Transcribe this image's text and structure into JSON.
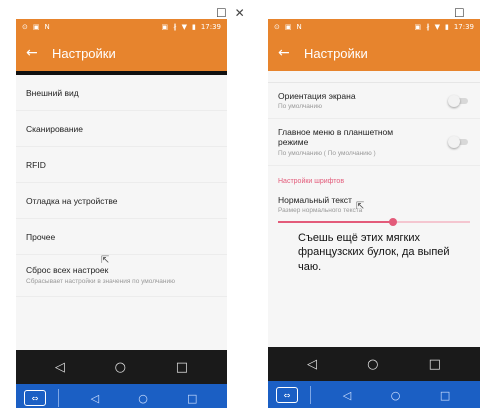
{
  "window_controls": "☐ ✕",
  "status_time": "17:39",
  "status_left_icons": [
    "⊙",
    "▣",
    "N"
  ],
  "status_right_icons": [
    "▣",
    "∦",
    "▼",
    "▮"
  ],
  "screen1": {
    "title": "Настройки",
    "back": "←",
    "items": [
      "Внешний вид",
      "Сканирование",
      "RFID",
      "Отладка на устройстве",
      "Прочее"
    ],
    "reset": {
      "title": "Сброс всех настроек",
      "summary": "Сбрасывает настройки в значения по умолчанию"
    }
  },
  "screen2": {
    "title": "Настройки",
    "back": "←",
    "orientation": {
      "title": "Ориентация экрана",
      "summary": "По умолчанию",
      "enabled": false
    },
    "tablet_menu": {
      "title": "Главное меню в планшетном режиме",
      "summary": "По умолчанию ( По умолчанию )",
      "enabled": false
    },
    "fonts_category": "Настройки шрифтов",
    "normal_text": {
      "title": "Нормальный текст",
      "summary": "Размер нормального текста",
      "slider_value": 0.6
    },
    "sample_text": "Съешь ещё этих мягких французских булок, да выпей чаю."
  },
  "nav": {
    "back": "◁",
    "home": "○",
    "recent": "□"
  },
  "bottom": {
    "app_icon": "⇔",
    "back": "◁",
    "home": "○",
    "recent": "□"
  },
  "colors": {
    "accent": "#e7842d",
    "category": "#e35b7a",
    "bottom_bar": "#1b5fc4"
  }
}
